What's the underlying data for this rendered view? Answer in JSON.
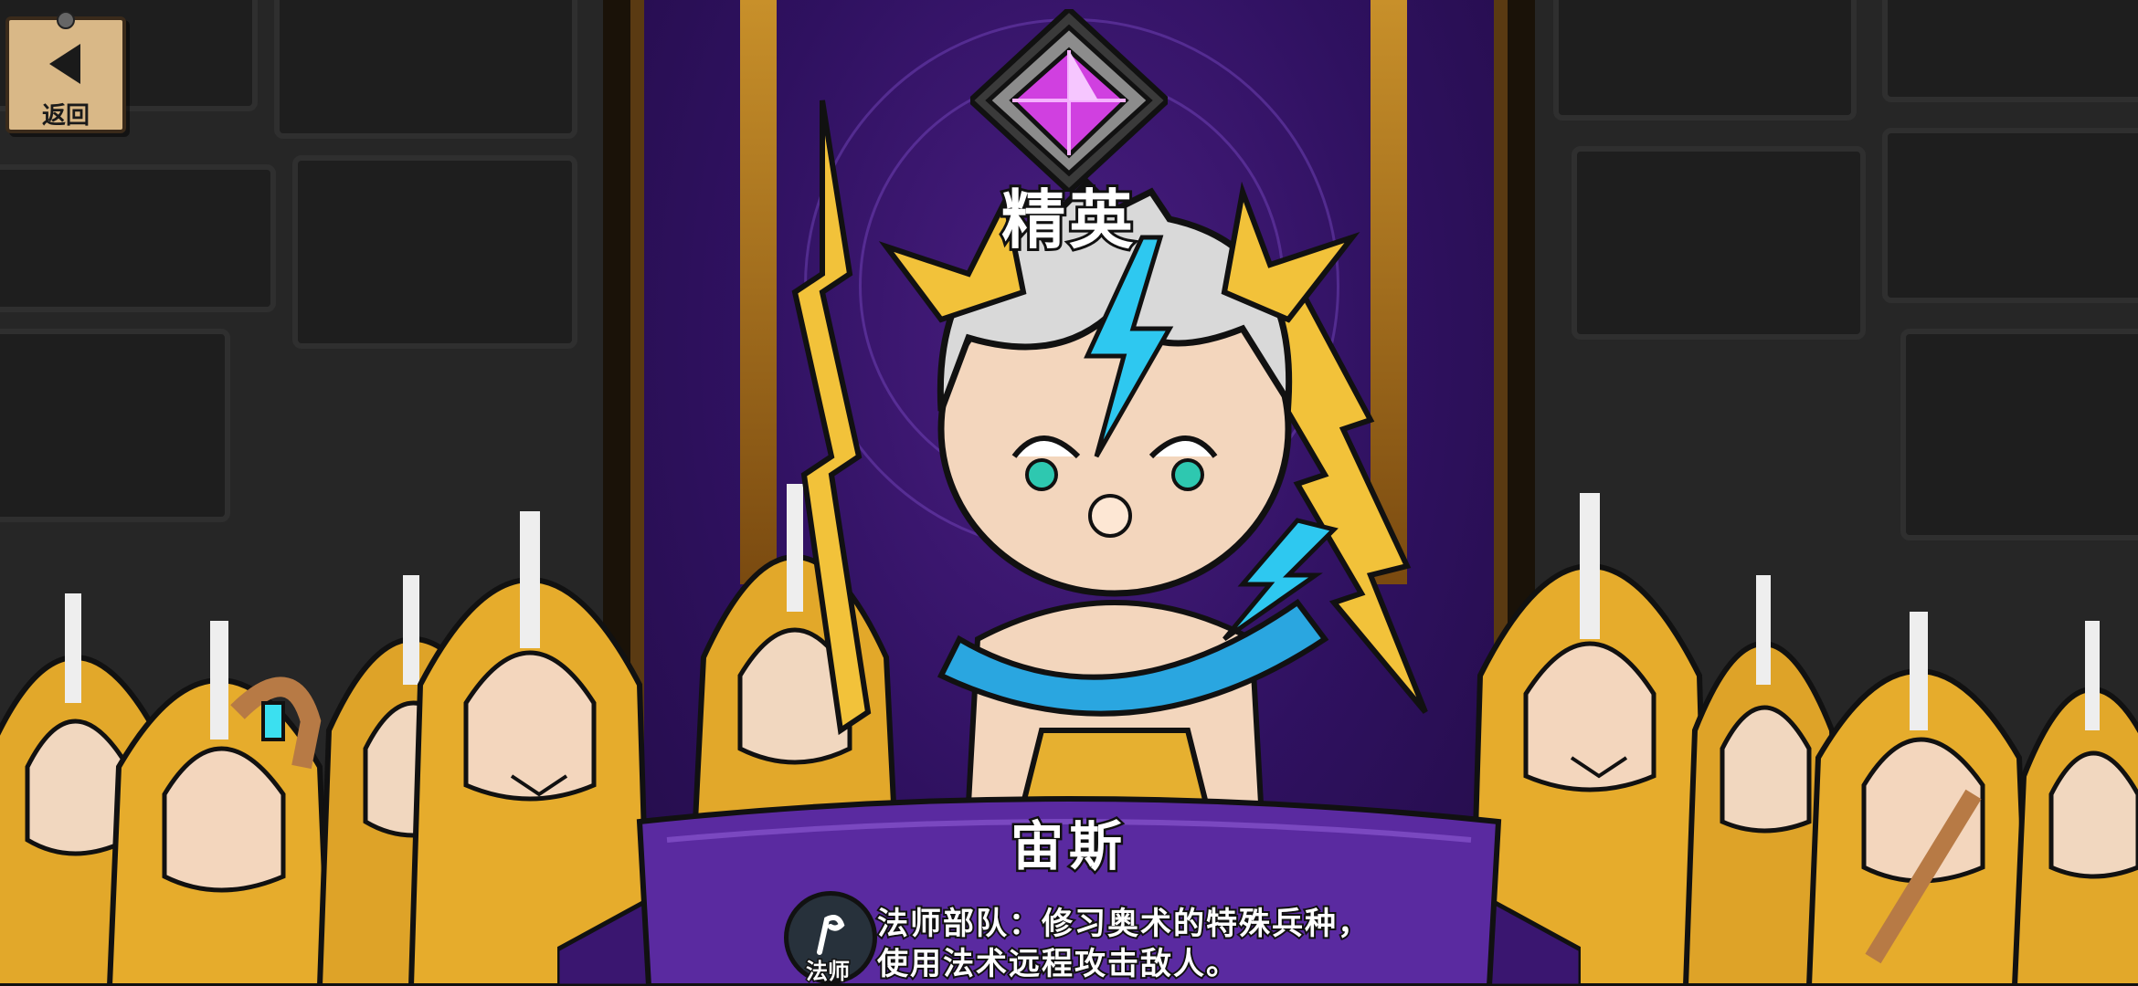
{
  "nav": {
    "back_label": "返回",
    "back_icon": "back-arrow-icon"
  },
  "unit": {
    "rank_label": "精英",
    "rank_icon": "purple-gem-icon",
    "name": "宙斯",
    "class_label": "法师",
    "class_icon": "magic-staff-icon",
    "description": "法师部队：修习奥术的特殊兵种，使用法术远程攻击敌人。"
  },
  "colors": {
    "banner_purple": "#2f1160",
    "ribbon_purple": "#5a2aa0",
    "gem": "#d040e0",
    "robe_gold": "#e2a82a"
  }
}
